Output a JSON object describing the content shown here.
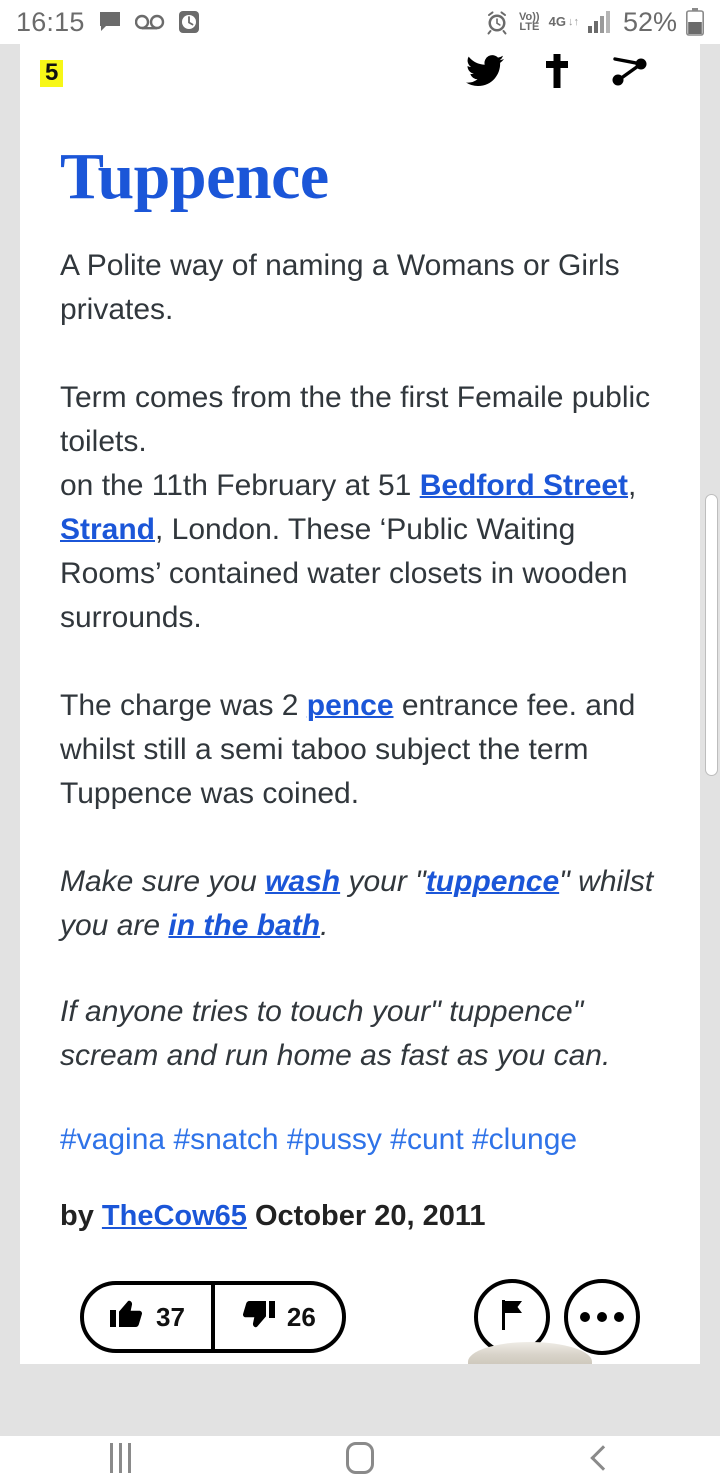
{
  "status_bar": {
    "time": "16:15",
    "left_icons": [
      "message-icon",
      "voicemail-icon",
      "alarm-clock-icon"
    ],
    "volte_label_top": "Vo))",
    "volte_label_bottom": "LTE",
    "network": "4G",
    "data_arrows": "↓↑",
    "battery_percent": "52%",
    "right_icons": [
      "alarm-icon",
      "volte-icon",
      "network-4g-icon",
      "signal-bars-icon",
      "battery-icon"
    ]
  },
  "page_header": {
    "count_badge": "5",
    "share_icons": [
      "twitter-icon",
      "dagger-icon",
      "share-icon"
    ]
  },
  "entry": {
    "title": "Tuppence",
    "definition_1": {
      "text": "A Polite way of naming a Womans or Girls privates."
    },
    "definition_2": {
      "part_1": "Term comes from the the first Femaile public toilets.",
      "part_2_pre": "on the 11th February at 51 ",
      "link_1": "Bedford Street",
      "part_2_mid": ", ",
      "link_2": "Strand",
      "part_2_post": ", London. These ‘Public Waiting Rooms’ contained water closets in wooden surrounds."
    },
    "definition_3": {
      "pre": "The charge was 2 ",
      "link": "pence",
      "post": " entrance fee. and whilst still a semi taboo subject the term Tuppence was coined."
    },
    "example_1": {
      "pre": "Make sure you ",
      "link_1": "wash",
      "mid_1": " your \"",
      "link_2": "tuppence",
      "mid_2": "\" whilst you are ",
      "link_3": "in the bath",
      "post": "."
    },
    "example_2": {
      "text": "If anyone tries to touch your\" tuppence\" scream and run home as fast as you can."
    },
    "tags": [
      "#vagina",
      "#snatch",
      "#pussy",
      "#cunt",
      "#clunge"
    ],
    "byline": {
      "by_label": "by ",
      "author": "TheCow65",
      "date": " October 20, 2011"
    },
    "actions": {
      "upvote_icon": "thumbs-up-icon",
      "upvote_count": "37",
      "downvote_icon": "thumbs-down-icon",
      "downvote_count": "26",
      "flag_icon": "flag-icon",
      "more_icon": "ellipsis-icon"
    }
  },
  "nav_bar": {
    "recents": "recents-icon",
    "home": "home-icon",
    "back": "back-icon"
  },
  "colors": {
    "link_blue": "#1b56d8",
    "tag_blue": "#2f73e8",
    "body_text": "#31373c",
    "badge_yellow": "#f7f717",
    "page_gray": "#e2e2e2"
  }
}
